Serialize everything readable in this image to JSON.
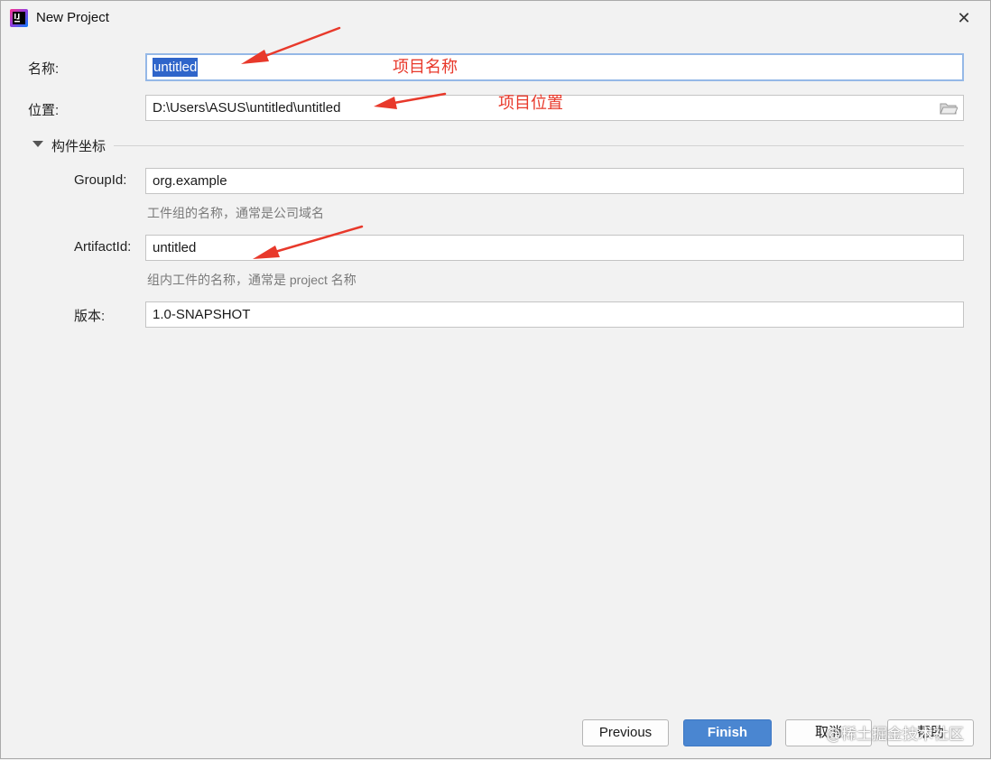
{
  "window": {
    "title": "New Project",
    "close_symbol": "✕"
  },
  "form": {
    "name_label": "名称:",
    "name_value": "untitled",
    "location_label": "位置:",
    "location_value": "D:\\Users\\ASUS\\untitled\\untitled",
    "section_title": "构件坐标",
    "groupid_label": "GroupId:",
    "groupid_value": "org.example",
    "groupid_hint": "工件组的名称，通常是公司域名",
    "artifactid_label": "ArtifactId:",
    "artifactid_value": "untitled",
    "artifactid_hint": "组内工件的名称，通常是 project 名称",
    "version_label": "版本:",
    "version_value": "1.0-SNAPSHOT"
  },
  "annotations": {
    "name_note": "项目名称",
    "location_note": "项目位置",
    "color": "#e8392b"
  },
  "buttons": {
    "previous": "Previous",
    "finish": "Finish",
    "cancel": "取消",
    "help": "帮助"
  },
  "watermark": "@稀土掘金技术社区",
  "colors": {
    "selection": "#2f65ca",
    "primary_button": "#4a86d1",
    "focus_border": "#95b8e7"
  }
}
